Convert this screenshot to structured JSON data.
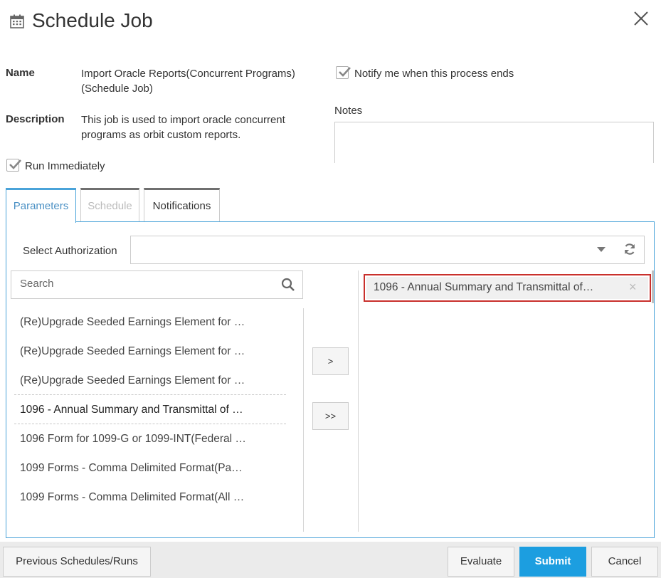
{
  "dialog": {
    "title": "Schedule Job"
  },
  "info": {
    "name_label": "Name",
    "name_line1": "Import Oracle Reports(Concurrent Programs)",
    "name_line2": "(Schedule Job)",
    "description_label": "Description",
    "description_line1": "This job is used to import oracle concurrent",
    "description_line2": "programs as orbit custom reports.",
    "notify_label": "Notify me when this process ends",
    "notify_checked": true,
    "notes_label": "Notes",
    "notes_value": "",
    "run_immediately_label": "Run Immediately",
    "run_immediately_checked": true
  },
  "tabs": [
    {
      "label": "Parameters",
      "state": "active"
    },
    {
      "label": "Schedule",
      "state": "disabled"
    },
    {
      "label": "Notifications",
      "state": "normal"
    }
  ],
  "parameters": {
    "select_authorization_label": "Select Authorization",
    "select_authorization_value": "",
    "search_placeholder": "Search",
    "available_items": [
      "(Re)Upgrade Seeded Earnings Element for …",
      "(Re)Upgrade Seeded Earnings Element for …",
      "(Re)Upgrade Seeded Earnings Element for …",
      "1096 - Annual Summary and Transmittal of …",
      "1096 Form for 1099-G or 1099-INT(Federal …",
      "1099 Forms - Comma Delimited Format(Pa…",
      "1099 Forms - Comma Delimited Format(All …"
    ],
    "move_one_label": ">",
    "move_all_label": ">>",
    "selected_items": [
      "1096 - Annual Summary and Transmittal of…"
    ],
    "remove_symbol": "×"
  },
  "footer": {
    "previous_label": "Previous Schedules/Runs",
    "evaluate_label": "Evaluate",
    "submit_label": "Submit",
    "cancel_label": "Cancel"
  },
  "colors": {
    "accent": "#4aa3d9",
    "primary_button": "#1c9ee0",
    "highlight_border": "#c9302c"
  }
}
